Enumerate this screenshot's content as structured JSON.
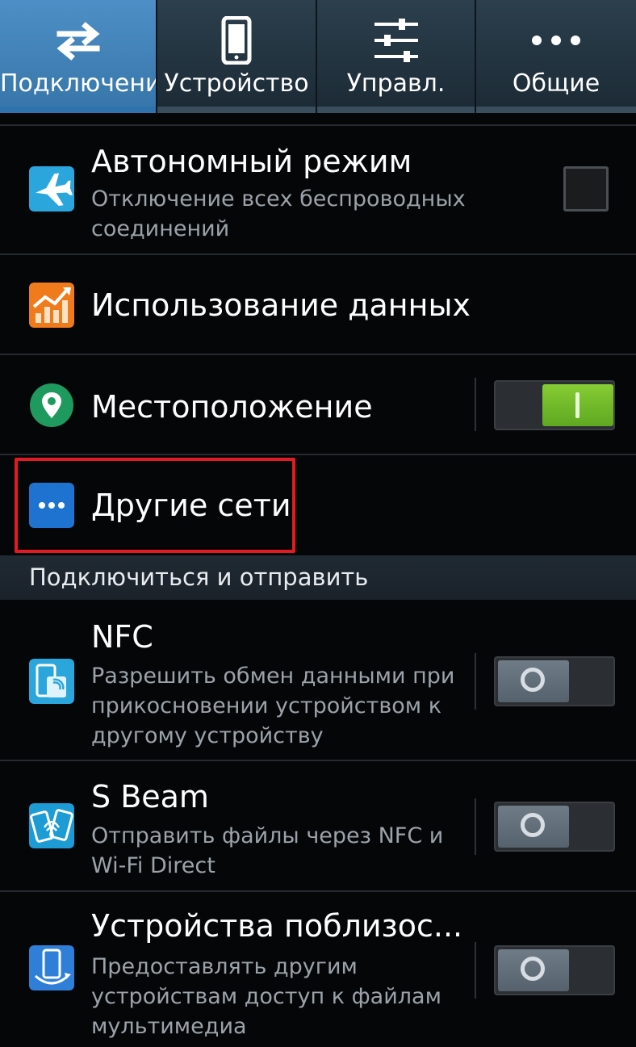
{
  "tabs": [
    {
      "label": "Подключени",
      "icon": "swap-arrows-icon",
      "active": true
    },
    {
      "label": "Устройство",
      "icon": "phone-icon",
      "active": false
    },
    {
      "label": "Управл.",
      "icon": "sliders-icon",
      "active": false
    },
    {
      "label": "Общие",
      "icon": "more-dots-icon",
      "active": false
    }
  ],
  "settings": {
    "airplane": {
      "title": "Автономный режим",
      "subtitle": "Отключение всех беспроводных соединений",
      "icon": "airplane-icon",
      "checked": false
    },
    "data_usage": {
      "title": "Использование данных",
      "icon": "data-usage-chart-icon"
    },
    "location": {
      "title": "Местоположение",
      "icon": "location-pin-icon",
      "switch": "on"
    },
    "other_networks": {
      "title": "Другие сети",
      "icon": "more-networks-icon"
    }
  },
  "section_header": "Подключиться и отправить",
  "connect": {
    "nfc": {
      "title": "NFC",
      "subtitle": "Разрешить обмен данными при прикосновении устройством к другому устройству",
      "icon": "nfc-icon",
      "switch": "off"
    },
    "sbeam": {
      "title": "S Beam",
      "subtitle": "Отправить файлы через NFC и Wi-Fi Direct",
      "icon": "sbeam-icon",
      "switch": "off"
    },
    "nearby": {
      "title": "Устройства поблизос...",
      "subtitle": "Предоставлять другим устройствам доступ к файлам мультимедиа",
      "icon": "nearby-devices-icon",
      "switch": "off"
    }
  },
  "colors": {
    "accent": "#3775a9",
    "highlight": "#e01b24",
    "switch_on": "#6fbb2a"
  }
}
